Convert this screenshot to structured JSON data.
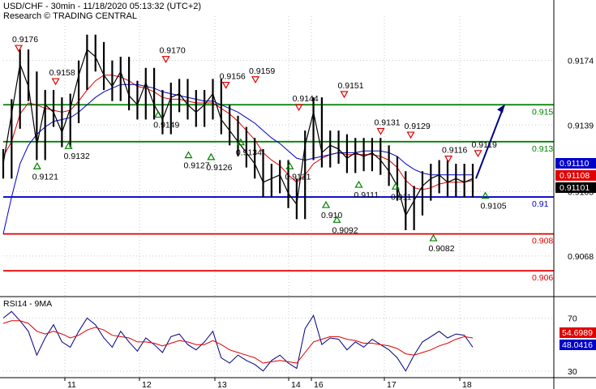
{
  "header": {
    "line1": "USD/CHF - 30min - 11/18/2020 05:13:32 (UTC+2)",
    "line2": "Research © TRADING CENTRAL"
  },
  "chart_data": [
    {
      "type": "line",
      "panel": "price",
      "price_axis_labels": [
        "0.9174",
        "0.9139",
        "0.9103",
        "0.9068"
      ],
      "price_axis_values": [
        0.9174,
        0.9139,
        0.9103,
        0.9068
      ],
      "ylim": [
        0.9046,
        0.9198
      ],
      "x_axis_labels": [
        "11",
        "12",
        "13",
        "14",
        "16",
        "17",
        "18"
      ],
      "levels": [
        {
          "label": "0.915",
          "value": 0.915,
          "color": "#008000"
        },
        {
          "label": "0.913",
          "value": 0.913,
          "color": "#008000"
        },
        {
          "label": "0.91",
          "value": 0.91,
          "color": "#0000c8"
        },
        {
          "label": "0.908",
          "value": 0.908,
          "color": "#e00000"
        },
        {
          "label": "0.906",
          "value": 0.906,
          "color": "#e00000"
        }
      ],
      "price_tags": [
        {
          "label": "0.91110",
          "value": 0.9111,
          "color": "#0000c8"
        },
        {
          "label": "0.91108",
          "value": 0.91108,
          "color": "#e00000"
        },
        {
          "label": "0.91101",
          "value": 0.91101,
          "color": "#000000"
        }
      ],
      "annotations": [
        {
          "text": "0.9176",
          "value": 0.9176,
          "kind": "high",
          "session": 0.25
        },
        {
          "text": "0.9158",
          "value": 0.9158,
          "kind": "high",
          "session": 0.85
        },
        {
          "text": "0.9170",
          "value": 0.917,
          "kind": "high",
          "session": 2.35
        },
        {
          "text": "0.9156",
          "value": 0.9156,
          "kind": "high",
          "session": 3.15
        },
        {
          "text": "0.9159",
          "value": 0.9159,
          "kind": "high",
          "session": 3.55
        },
        {
          "text": "0.9144",
          "value": 0.9144,
          "kind": "high",
          "session": 4.45
        },
        {
          "text": "0.9151",
          "value": 0.9151,
          "kind": "high",
          "session": 5.45
        },
        {
          "text": "0.9131",
          "value": 0.9131,
          "kind": "high",
          "session": 5.95
        },
        {
          "text": "0.9129",
          "value": 0.9129,
          "kind": "high",
          "session": 6.35
        },
        {
          "text": "0.9116",
          "value": 0.9116,
          "kind": "high",
          "session": 6.85
        },
        {
          "text": "0.9119",
          "value": 0.9119,
          "kind": "high",
          "session": 7.25
        },
        {
          "text": "0.9121",
          "value": 0.9121,
          "kind": "low",
          "session": 0.55
        },
        {
          "text": "0.9132",
          "value": 0.9132,
          "kind": "low",
          "session": 1.05
        },
        {
          "text": "0.9149",
          "value": 0.9149,
          "kind": "low",
          "session": 2.25
        },
        {
          "text": "0.9127",
          "value": 0.9127,
          "kind": "low",
          "session": 2.65
        },
        {
          "text": "0.9126",
          "value": 0.9126,
          "kind": "low",
          "session": 2.95
        },
        {
          "text": "0.9134",
          "value": 0.9134,
          "kind": "low",
          "session": 3.35
        },
        {
          "text": "0.9121",
          "value": 0.9121,
          "kind": "low",
          "session": 4.05
        },
        {
          "text": "0.910",
          "value": 0.91,
          "kind": "low",
          "session": 5.2
        },
        {
          "text": "0.9092",
          "value": 0.9092,
          "kind": "low",
          "session": 5.35
        },
        {
          "text": "0.9111",
          "value": 0.9111,
          "kind": "low",
          "session": 5.65
        },
        {
          "text": "0.911",
          "value": 0.911,
          "kind": "low",
          "session": 6.15
        },
        {
          "text": "0.9082",
          "value": 0.9082,
          "kind": "low",
          "session": 6.65
        },
        {
          "text": "0.9105",
          "value": 0.9105,
          "kind": "low",
          "session": 7.35
        }
      ],
      "series": [
        {
          "name": "USD/CHF",
          "values": [
            0.9118,
            0.9145,
            0.9172,
            0.916,
            0.9128,
            0.915,
            0.9146,
            0.9135,
            0.9148,
            0.9166,
            0.918,
            0.9176,
            0.9166,
            0.916,
            0.9168,
            0.9155,
            0.915,
            0.9162,
            0.915,
            0.9142,
            0.9154,
            0.9156,
            0.915,
            0.9146,
            0.915,
            0.9156,
            0.9142,
            0.9136,
            0.913,
            0.9124,
            0.9118,
            0.9108,
            0.911,
            0.9112,
            0.9102,
            0.9096,
            0.9128,
            0.9146,
            0.9124,
            0.9128,
            0.9126,
            0.9121,
            0.9124,
            0.9122,
            0.9124,
            0.912,
            0.9114,
            0.9106,
            0.909,
            0.9098,
            0.9106,
            0.911,
            0.9112,
            0.9108,
            0.911,
            0.9108,
            0.911
          ]
        },
        {
          "name": "MA20",
          "color": "#e00000",
          "values": [
            0.9122,
            0.913,
            0.9145,
            0.9151,
            0.915,
            0.9148,
            0.9147,
            0.9146,
            0.9147,
            0.9152,
            0.9158,
            0.9163,
            0.9166,
            0.9166,
            0.9165,
            0.9163,
            0.916,
            0.9159,
            0.9157,
            0.9154,
            0.9153,
            0.9153,
            0.9152,
            0.9151,
            0.9151,
            0.9151,
            0.9148,
            0.9145,
            0.9141,
            0.9136,
            0.9131,
            0.9124,
            0.912,
            0.9117,
            0.9112,
            0.9108,
            0.9112,
            0.9118,
            0.9121,
            0.9123,
            0.9124,
            0.9123,
            0.9123,
            0.9123,
            0.9123,
            0.9122,
            0.912,
            0.9116,
            0.9109,
            0.9105,
            0.9104,
            0.9105,
            0.9107,
            0.9108,
            0.9108,
            0.9108,
            0.9109
          ]
        },
        {
          "name": "MA50",
          "color": "#0000c8",
          "values": [
            0.908,
            0.91,
            0.9118,
            0.9128,
            0.9134,
            0.9138,
            0.9141,
            0.9142,
            0.9143,
            0.9146,
            0.915,
            0.9154,
            0.9157,
            0.9159,
            0.9161,
            0.9161,
            0.9161,
            0.916,
            0.9159,
            0.9157,
            0.9156,
            0.9155,
            0.9154,
            0.9153,
            0.9152,
            0.9152,
            0.915,
            0.9148,
            0.9146,
            0.9143,
            0.914,
            0.9136,
            0.9132,
            0.9129,
            0.9125,
            0.9121,
            0.912,
            0.9121,
            0.9122,
            0.9123,
            0.9124,
            0.9124,
            0.9124,
            0.9125,
            0.9125,
            0.9125,
            0.9124,
            0.9122,
            0.9118,
            0.9115,
            0.9113,
            0.9112,
            0.9112,
            0.9112,
            0.9112,
            0.9112,
            0.9112
          ]
        }
      ],
      "forecast_arrow": {
        "from": 0.911,
        "to": 0.915
      }
    },
    {
      "type": "line",
      "panel": "indicator",
      "title": "RSI14 - 9MA",
      "axis_labels": [
        "70",
        "30"
      ],
      "axis_values": [
        70,
        30
      ],
      "ylim": [
        25,
        85
      ],
      "value_tags": [
        {
          "label": "54.6989",
          "value": 54.6989,
          "color": "#e00000"
        },
        {
          "label": "48.0416",
          "value": 48.0416,
          "color": "#0000c8"
        }
      ],
      "series": [
        {
          "name": "RSI14",
          "color": "#000080",
          "values": [
            70,
            75,
            68,
            60,
            42,
            55,
            65,
            52,
            48,
            60,
            70,
            65,
            55,
            48,
            60,
            52,
            45,
            55,
            50,
            44,
            56,
            58,
            50,
            46,
            52,
            60,
            40,
            36,
            42,
            38,
            35,
            30,
            38,
            42,
            36,
            32,
            62,
            72,
            50,
            55,
            54,
            46,
            52,
            48,
            54,
            50,
            46,
            40,
            30,
            42,
            52,
            56,
            60,
            55,
            58,
            57,
            48
          ]
        },
        {
          "name": "9MA",
          "color": "#e00000",
          "values": [
            66,
            68,
            68,
            66,
            60,
            58,
            60,
            58,
            55,
            57,
            61,
            63,
            61,
            57,
            56,
            55,
            52,
            52,
            51,
            49,
            51,
            53,
            52,
            50,
            50,
            53,
            50,
            46,
            44,
            42,
            40,
            36,
            37,
            38,
            37,
            36,
            44,
            52,
            54,
            56,
            56,
            54,
            53,
            51,
            51,
            50,
            49,
            47,
            43,
            42,
            44,
            46,
            49,
            51,
            54,
            56,
            55
          ]
        }
      ]
    }
  ]
}
